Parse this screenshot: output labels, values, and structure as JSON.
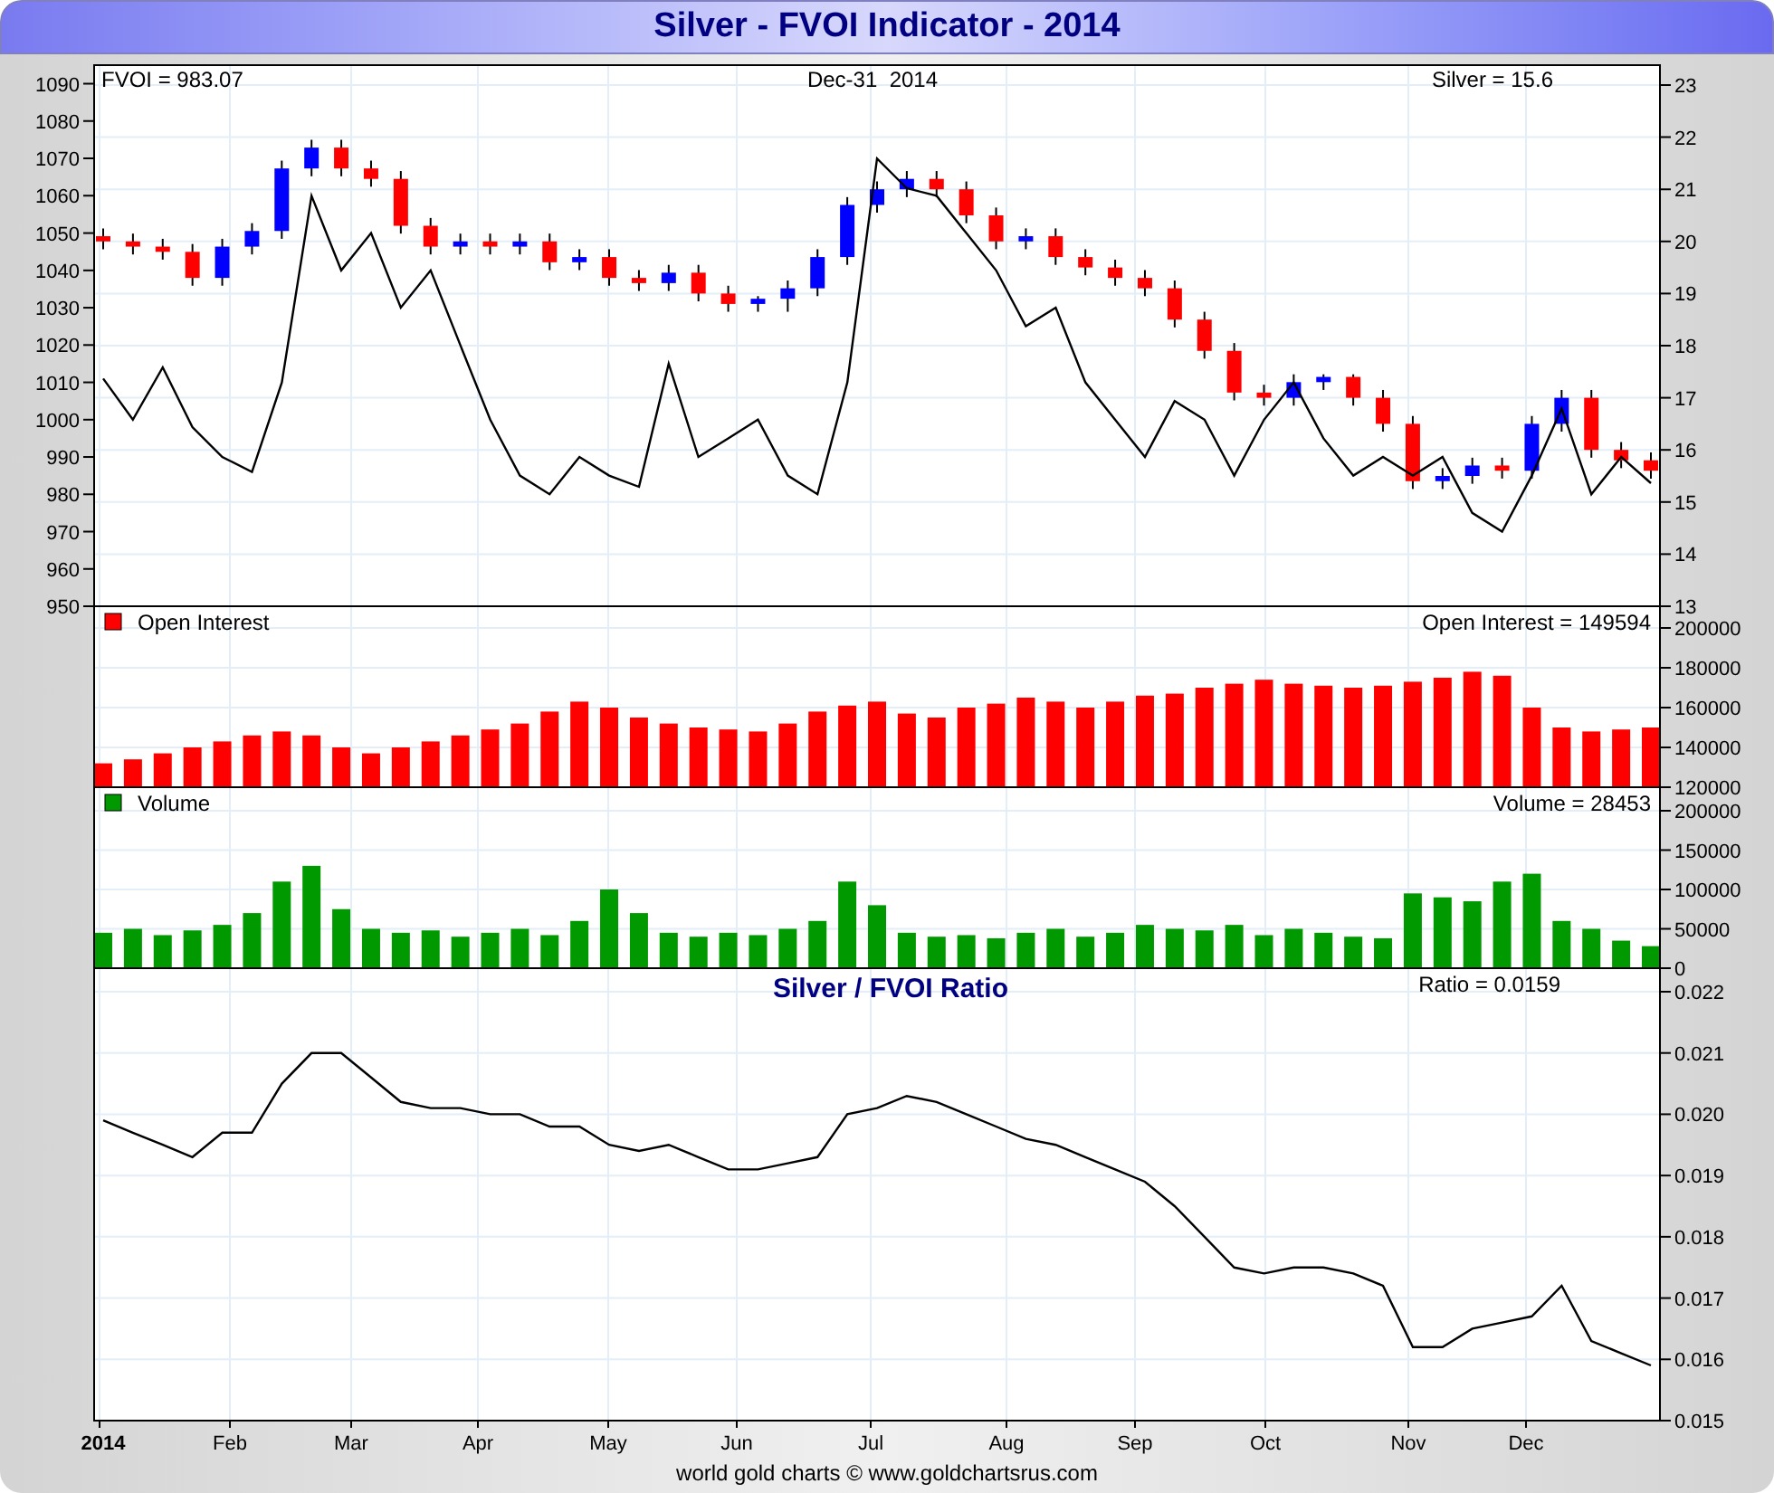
{
  "title": "Silver - FVOI Indicator - 2014",
  "price_panel": {
    "indicator_reading": "FVOI = 983.07",
    "date": "Dec-31  2014",
    "price_reading": "Silver = 15.6",
    "chart_data": {
      "type": "candlestick",
      "grid": true,
      "ylim": [
        13,
        23
      ],
      "yticks": [
        13,
        14,
        15,
        16,
        17,
        18,
        19,
        20,
        21,
        22,
        23
      ],
      "ohlc": [
        [
          20.1,
          20.25,
          19.85,
          20.0
        ],
        [
          20.0,
          20.15,
          19.75,
          19.9
        ],
        [
          19.9,
          20.05,
          19.65,
          19.8
        ],
        [
          19.8,
          19.95,
          19.15,
          19.3
        ],
        [
          19.3,
          20.05,
          19.15,
          19.9
        ],
        [
          19.9,
          20.35,
          19.75,
          20.2
        ],
        [
          20.2,
          21.55,
          20.05,
          21.4
        ],
        [
          21.4,
          21.95,
          21.25,
          21.8
        ],
        [
          21.8,
          21.95,
          21.25,
          21.4
        ],
        [
          21.4,
          21.55,
          21.05,
          21.2
        ],
        [
          21.2,
          21.35,
          20.15,
          20.3
        ],
        [
          20.3,
          20.45,
          19.75,
          19.9
        ],
        [
          19.9,
          20.15,
          19.75,
          20.0
        ],
        [
          20.0,
          20.15,
          19.75,
          19.9
        ],
        [
          19.9,
          20.15,
          19.75,
          20.0
        ],
        [
          20.0,
          20.15,
          19.45,
          19.6
        ],
        [
          19.6,
          19.85,
          19.45,
          19.7
        ],
        [
          19.7,
          19.85,
          19.15,
          19.3
        ],
        [
          19.3,
          19.45,
          19.05,
          19.2
        ],
        [
          19.2,
          19.55,
          19.05,
          19.4
        ],
        [
          19.4,
          19.55,
          18.85,
          19.0
        ],
        [
          19.0,
          19.15,
          18.65,
          18.8
        ],
        [
          18.8,
          18.95,
          18.65,
          18.9
        ],
        [
          18.9,
          19.25,
          18.65,
          19.1
        ],
        [
          19.1,
          19.85,
          18.95,
          19.7
        ],
        [
          19.7,
          20.85,
          19.55,
          20.7
        ],
        [
          20.7,
          21.15,
          20.55,
          21.0
        ],
        [
          21.0,
          21.35,
          20.85,
          21.2
        ],
        [
          21.2,
          21.35,
          20.85,
          21.0
        ],
        [
          21.0,
          21.15,
          20.35,
          20.5
        ],
        [
          20.5,
          20.65,
          19.85,
          20.0
        ],
        [
          20.0,
          20.25,
          19.85,
          20.1
        ],
        [
          20.1,
          20.25,
          19.55,
          19.7
        ],
        [
          19.7,
          19.85,
          19.35,
          19.5
        ],
        [
          19.5,
          19.65,
          19.15,
          19.3
        ],
        [
          19.3,
          19.45,
          18.95,
          19.1
        ],
        [
          19.1,
          19.25,
          18.35,
          18.5
        ],
        [
          18.5,
          18.65,
          17.75,
          17.9
        ],
        [
          17.9,
          18.05,
          16.95,
          17.1
        ],
        [
          17.1,
          17.25,
          16.85,
          17.0
        ],
        [
          17.0,
          17.45,
          16.85,
          17.3
        ],
        [
          17.3,
          17.45,
          17.15,
          17.4
        ],
        [
          17.4,
          17.45,
          16.85,
          17.0
        ],
        [
          17.0,
          17.15,
          16.35,
          16.5
        ],
        [
          16.5,
          16.65,
          15.25,
          15.4
        ],
        [
          15.4,
          15.65,
          15.25,
          15.5
        ],
        [
          15.5,
          15.85,
          15.35,
          15.7
        ],
        [
          15.7,
          15.85,
          15.45,
          15.6
        ],
        [
          15.6,
          16.65,
          15.45,
          16.5
        ],
        [
          16.5,
          17.15,
          16.35,
          17.0
        ],
        [
          17.0,
          17.15,
          15.85,
          16.0
        ],
        [
          16.0,
          16.15,
          15.65,
          15.8
        ],
        [
          15.8,
          15.95,
          15.45,
          15.6
        ]
      ]
    },
    "indicator": {
      "chart_data": {
        "type": "line",
        "ylim": [
          950,
          1095
        ],
        "yticks": [
          950,
          960,
          970,
          980,
          990,
          1000,
          1010,
          1020,
          1030,
          1040,
          1050,
          1060,
          1070,
          1080,
          1090
        ],
        "series": [
          {
            "color": "#000000",
            "values": [
              1011,
              1000,
              1014,
              998,
              990,
              986,
              1010,
              1060,
              1040,
              1050,
              1030,
              1040,
              1020,
              1000,
              985,
              980,
              990,
              985,
              982,
              1015,
              990,
              995,
              1000,
              985,
              980,
              1010,
              1070,
              1062,
              1060,
              1050,
              1040,
              1025,
              1030,
              1010,
              1000,
              990,
              1005,
              1000,
              985,
              1000,
              1010,
              995,
              985,
              990,
              985,
              990,
              975,
              970,
              985,
              1003,
              980,
              990,
              983
            ]
          }
        ]
      }
    }
  },
  "open_interest_panel": {
    "reading": "Open Interest = 149594",
    "chart_data": {
      "type": "bar",
      "grid": true,
      "ylim": [
        120000,
        200000
      ],
      "yticks": [
        120000,
        140000,
        160000,
        180000,
        200000
      ],
      "series": [
        {
          "name": "Open Interest",
          "color": "#ff0000",
          "values": [
            132000,
            134000,
            137000,
            140000,
            143000,
            146000,
            148000,
            146000,
            140000,
            137000,
            140000,
            143000,
            146000,
            149000,
            152000,
            158000,
            163000,
            160000,
            155000,
            152000,
            150000,
            149000,
            148000,
            152000,
            158000,
            161000,
            163000,
            157000,
            155000,
            160000,
            162000,
            165000,
            163000,
            160000,
            163000,
            166000,
            167000,
            170000,
            172000,
            174000,
            172000,
            171000,
            170000,
            171000,
            173000,
            175000,
            178000,
            176000,
            160000,
            150000,
            148000,
            149000,
            150000
          ]
        }
      ]
    }
  },
  "volume_panel": {
    "reading": "Volume = 28453",
    "chart_data": {
      "type": "bar",
      "grid": true,
      "ylim": [
        0,
        200000
      ],
      "yticks": [
        0,
        50000,
        100000,
        150000,
        200000
      ],
      "series": [
        {
          "name": "Volume",
          "color": "#009900",
          "values": [
            45000,
            50000,
            42000,
            48000,
            55000,
            70000,
            110000,
            130000,
            75000,
            50000,
            45000,
            48000,
            40000,
            45000,
            50000,
            42000,
            60000,
            100000,
            70000,
            45000,
            40000,
            45000,
            42000,
            50000,
            60000,
            110000,
            80000,
            45000,
            40000,
            42000,
            38000,
            45000,
            50000,
            40000,
            45000,
            55000,
            50000,
            48000,
            55000,
            42000,
            50000,
            45000,
            40000,
            38000,
            95000,
            90000,
            85000,
            110000,
            120000,
            60000,
            50000,
            35000,
            28000
          ]
        }
      ]
    }
  },
  "ratio_panel": {
    "reading": "Ratio = 0.0159",
    "chart_data": {
      "type": "line",
      "grid": true,
      "title": "Silver / FVOI Ratio",
      "ylim": [
        0.015,
        0.022
      ],
      "yticks": [
        {
          "value": 0.015,
          "label": "0.015"
        },
        {
          "value": 0.016,
          "label": "0.016"
        },
        {
          "value": 0.017,
          "label": "0.017"
        },
        {
          "value": 0.018,
          "label": "0.018"
        },
        {
          "value": 0.019,
          "label": "0.019"
        },
        {
          "value": 0.02,
          "label": "0.020"
        },
        {
          "value": 0.021,
          "label": "0.021"
        },
        {
          "value": 0.022,
          "label": "0.022"
        }
      ],
      "series": [
        {
          "color": "#000000",
          "values": [
            0.0199,
            0.0197,
            0.0195,
            0.0193,
            0.0197,
            0.0197,
            0.0205,
            0.021,
            0.021,
            0.0206,
            0.0202,
            0.0201,
            0.0201,
            0.02,
            0.02,
            0.0198,
            0.0198,
            0.0195,
            0.0194,
            0.0195,
            0.0193,
            0.0191,
            0.0191,
            0.0192,
            0.0193,
            0.02,
            0.0201,
            0.0203,
            0.0202,
            0.02,
            0.0198,
            0.0196,
            0.0195,
            0.0193,
            0.0191,
            0.0189,
            0.0185,
            0.018,
            0.0175,
            0.0174,
            0.0175,
            0.0175,
            0.0174,
            0.0172,
            0.0162,
            0.0162,
            0.0165,
            0.0166,
            0.0167,
            0.0172,
            0.0163,
            0.0161,
            0.0159
          ]
        }
      ]
    }
  },
  "x_axis": {
    "ticks": [
      {
        "label": "2014",
        "kind": "year"
      },
      {
        "label": "Feb",
        "kind": "month"
      },
      {
        "label": "Mar",
        "kind": "month"
      },
      {
        "label": "Apr",
        "kind": "month"
      },
      {
        "label": "May",
        "kind": "month"
      },
      {
        "label": "Jun",
        "kind": "month"
      },
      {
        "label": "Jul",
        "kind": "month"
      },
      {
        "label": "Aug",
        "kind": "month"
      },
      {
        "label": "Sep",
        "kind": "month"
      },
      {
        "label": "Oct",
        "kind": "month"
      },
      {
        "label": "Nov",
        "kind": "month"
      },
      {
        "label": "Dec",
        "kind": "month"
      }
    ]
  },
  "footer": "world gold charts © www.goldchartsrus.com"
}
